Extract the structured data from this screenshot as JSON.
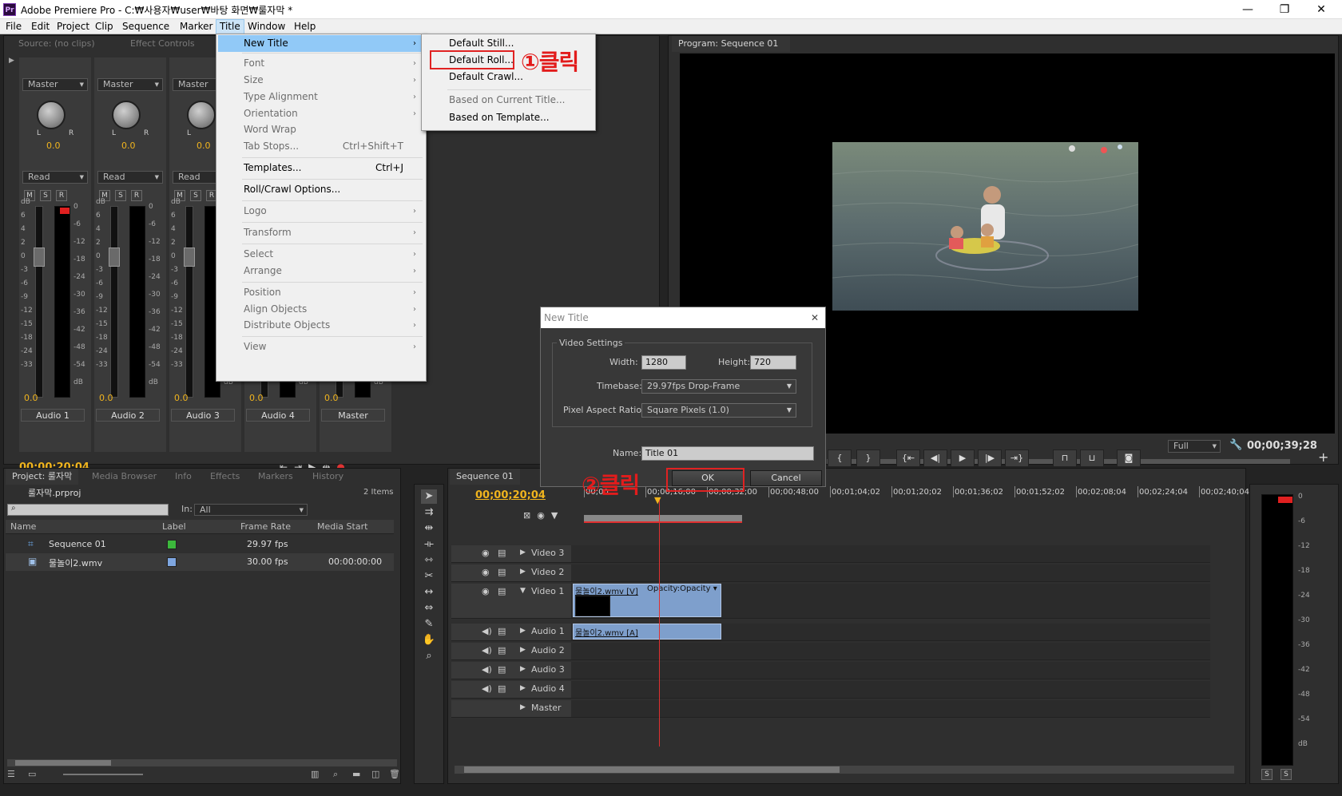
{
  "window": {
    "title": "Adobe Premiere Pro - C:₩사용자₩user₩바탕 화면₩룰자막 *",
    "app_icon": "Pr",
    "minimize": "—",
    "maximize": "❐",
    "close": "✕"
  },
  "menubar": [
    "File",
    "Edit",
    "Project",
    "Clip",
    "Sequence",
    "Marker",
    "Title",
    "Window",
    "Help"
  ],
  "source_panel": {
    "tabs": [
      "Source: (no clips)",
      "Effect Controls"
    ]
  },
  "mixer": {
    "channels": [
      {
        "name": "Audio 1",
        "mode": "Master",
        "automation": "Read",
        "pan": "0.0",
        "vol": "0.0",
        "has_l": "L",
        "has_r": "R"
      },
      {
        "name": "Audio 2",
        "mode": "Master",
        "automation": "Read",
        "pan": "0.0",
        "vol": "0.0",
        "has_l": "L",
        "has_r": "R"
      },
      {
        "name": "Audio 3",
        "mode": "Master",
        "automation": "Read",
        "pan": "0.0",
        "vol": "0.0",
        "has_l": "L",
        "has_r": "R"
      },
      {
        "name": "Audio 4",
        "mode": "",
        "automation": "",
        "pan": "",
        "vol": "0.0",
        "has_l": "",
        "has_r": ""
      },
      {
        "name": "Master",
        "mode": "",
        "automation": "",
        "pan": "",
        "vol": "0.0",
        "has_l": "",
        "has_r": ""
      }
    ],
    "msr": [
      "M",
      "S",
      "R"
    ],
    "db_left": [
      "dB",
      "6",
      "4",
      "2",
      "0",
      "-3",
      "-6",
      "-9",
      "-12",
      "-15",
      "-18",
      "-24",
      "-33"
    ],
    "db_right": [
      "0",
      "-6",
      "-12",
      "-18",
      "-24",
      "-30",
      "-36",
      "-42",
      "-48",
      "-54",
      "dB"
    ],
    "timecode": "00;00;20;04",
    "peak_color": "#e02020"
  },
  "title_menu": {
    "items": [
      {
        "label": "New Title",
        "shortcut": "",
        "arrow": "›"
      },
      {
        "label": "Font",
        "shortcut": "",
        "arrow": "›"
      },
      {
        "label": "Size",
        "shortcut": "",
        "arrow": "›"
      },
      {
        "label": "Type Alignment",
        "shortcut": "",
        "arrow": "›"
      },
      {
        "label": "Orientation",
        "shortcut": "",
        "arrow": "›"
      },
      {
        "label": "Word Wrap",
        "shortcut": "",
        "arrow": ""
      },
      {
        "label": "Tab Stops...",
        "shortcut": "Ctrl+Shift+T",
        "arrow": ""
      },
      {
        "label": "Templates...",
        "shortcut": "Ctrl+J",
        "arrow": ""
      },
      {
        "label": "Roll/Crawl Options...",
        "shortcut": "",
        "arrow": ""
      },
      {
        "label": "Logo",
        "shortcut": "",
        "arrow": "›"
      },
      {
        "label": "Transform",
        "shortcut": "",
        "arrow": "›"
      },
      {
        "label": "Select",
        "shortcut": "",
        "arrow": "›"
      },
      {
        "label": "Arrange",
        "shortcut": "",
        "arrow": "›"
      },
      {
        "label": "Position",
        "shortcut": "",
        "arrow": "›"
      },
      {
        "label": "Align Objects",
        "shortcut": "",
        "arrow": "›"
      },
      {
        "label": "Distribute Objects",
        "shortcut": "",
        "arrow": "›"
      },
      {
        "label": "View",
        "shortcut": "",
        "arrow": "›"
      }
    ]
  },
  "new_title_submenu": [
    "Default Still...",
    "Default Roll...",
    "Default Crawl...",
    "Based on Current Title...",
    "Based on Template..."
  ],
  "annotations": {
    "step1": "①클릭",
    "step2": "②클릭",
    "box_color": "#e02222"
  },
  "program_monitor": {
    "tab": "Program: Sequence 01",
    "zoom": "Full",
    "timecode": "00;00;39;28"
  },
  "dialog": {
    "title": "New Title",
    "close": "✕",
    "group": "Video Settings",
    "width_label": "Width:",
    "width": "1280",
    "height_label": "Height:",
    "height": "720",
    "timebase_label": "Timebase:",
    "timebase": "29.97fps Drop-Frame",
    "par_label": "Pixel Aspect Ratio:",
    "par": "Square Pixels (1.0)",
    "name_label": "Name:",
    "name": "Title 01",
    "ok": "OK",
    "cancel": "Cancel"
  },
  "project_panel": {
    "tabs": [
      "Project: 룰자막",
      "Media Browser",
      "Info",
      "Effects",
      "Markers",
      "History"
    ],
    "project_file": "룰자막.prproj",
    "item_count": "2 Items",
    "search_placeholder": "",
    "in_label": "In:",
    "in_value": "All",
    "columns": [
      "Name",
      "Label",
      "Frame Rate",
      "Media Start"
    ],
    "rows": [
      {
        "name": "Sequence 01",
        "label_color": "#3cb83c",
        "frame_rate": "29.97 fps",
        "media_start": ""
      },
      {
        "name": "물놀이2.wmv",
        "label_color": "#7ea6e0",
        "frame_rate": "30.00 fps",
        "media_start": "00:00:00:00"
      }
    ]
  },
  "timeline": {
    "tab": "Sequence 01",
    "timecode": "00;00;20;04",
    "ruler": [
      "00;00",
      "00;00;16;00",
      "00;00;32;00",
      "00;00;48;00",
      "00;01;04;02",
      "00;01;20;02",
      "00;01;36;02",
      "00;01;52;02",
      "00;02;08;04",
      "00;02;24;04",
      "00;02;40;04"
    ],
    "video_tracks": [
      "Video 3",
      "Video 2",
      "Video 1"
    ],
    "audio_tracks": [
      "Audio 1",
      "Audio 2",
      "Audio 3",
      "Audio 4",
      "Master"
    ],
    "video_clip": "물놀이2.wmv [V]",
    "video_clip_fx": "Opacity:Opacity ▾",
    "audio_clip": "물놀이2.wmv [A]"
  },
  "master_meter": {
    "db": [
      "0",
      "-6",
      "-12",
      "-18",
      "-24",
      "-30",
      "-36",
      "-42",
      "-48",
      "-54",
      "dB"
    ],
    "s1": "S",
    "s2": "S"
  }
}
